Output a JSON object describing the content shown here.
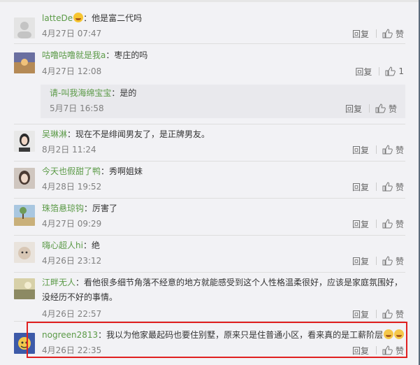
{
  "ui": {
    "reply_label": "回复",
    "like_label": "赞",
    "colon": "："
  },
  "comments": [
    {
      "user": "latteDe",
      "text": "他是富二代吗",
      "time": "4月27日 07:47",
      "likes": ""
    },
    {
      "user": "咕噜咕噜就是我a",
      "text": "枣庄的吗",
      "time": "4月27日 12:08",
      "likes": "1"
    },
    {
      "user": "请-叫我海绵宝宝",
      "text": "是的",
      "time": "5月7日 16:58",
      "likes": ""
    },
    {
      "user": "吴琳淋",
      "text": "现在不是绯闻男友了，是正牌男友。",
      "time": "8月2日 11:24",
      "likes": ""
    },
    {
      "user": "今天也假甜了鸭",
      "text": "秀啊姐妹",
      "time": "4月28日 19:52",
      "likes": ""
    },
    {
      "user": "珠箔悬琼钩",
      "text": "厉害了",
      "time": "4月27日 09:29",
      "likes": ""
    },
    {
      "user": "嗨心超人hi",
      "text": "绝",
      "time": "4月26日 23:12",
      "likes": ""
    },
    {
      "user": "江畔无人",
      "text": "看他很多细节角落不经意的地方就能感受到这个人性格温柔很好，应该是家庭氛围好，没经历不好的事情。",
      "time": "4月26日 22:57",
      "likes": ""
    },
    {
      "user": "nogreen2813",
      "text": "我以为他家最起码也要住别墅，原来只是住普通小区，看来真的是工薪阶层",
      "time": "4月26日 22:35",
      "likes": ""
    }
  ],
  "colors": {
    "username": "#5b9a47",
    "highlight_border": "#e02020",
    "background": "#f2f2f5"
  }
}
